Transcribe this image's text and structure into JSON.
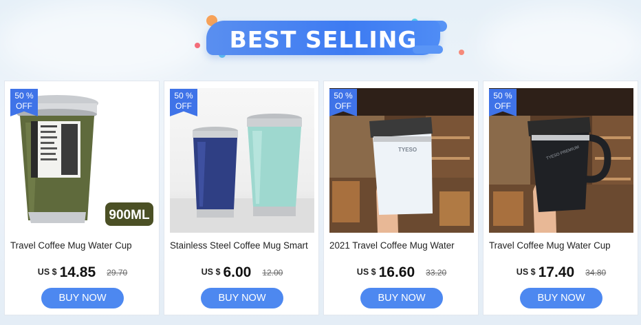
{
  "banner": {
    "title": "BEST SELLING"
  },
  "products": [
    {
      "badge_pct": "50 %",
      "badge_off": "OFF",
      "title": "Travel Coffee Mug Water Cup",
      "currency": "US $",
      "price": "14.85",
      "old_price": "29.70",
      "buy_label": "BUY NOW",
      "image_label": "900ML"
    },
    {
      "badge_pct": "50 %",
      "badge_off": "OFF",
      "title": "Stainless Steel Coffee Mug Smart",
      "currency": "US $",
      "price": "6.00",
      "old_price": "12.00",
      "buy_label": "BUY NOW"
    },
    {
      "badge_pct": "50 %",
      "badge_off": "OFF",
      "title": "2021 Travel Coffee Mug Water",
      "currency": "US $",
      "price": "16.60",
      "old_price": "33.20",
      "buy_label": "BUY NOW"
    },
    {
      "badge_pct": "50 %",
      "badge_off": "OFF",
      "title": "Travel Coffee Mug Water Cup",
      "currency": "US $",
      "price": "17.40",
      "old_price": "34.80",
      "buy_label": "BUY NOW"
    }
  ],
  "colors": {
    "accent": "#4d88f0",
    "badge": "#3f73e8",
    "banner": "#3d7bf2"
  }
}
